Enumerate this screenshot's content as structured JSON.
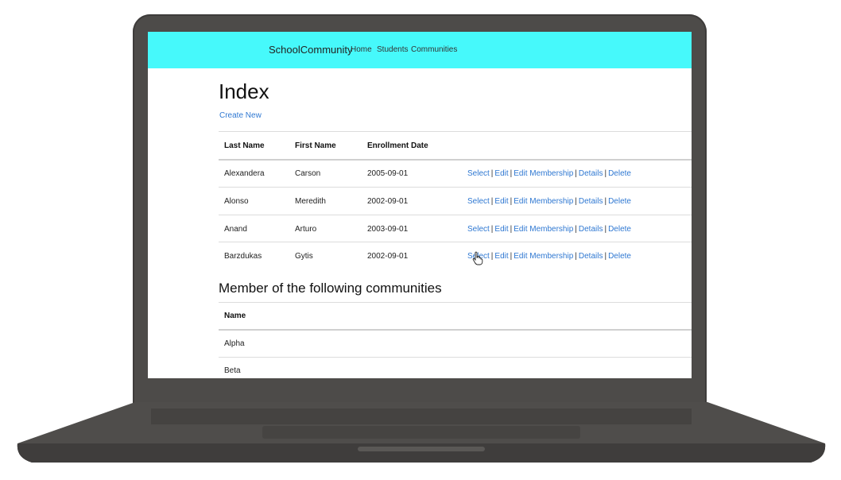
{
  "navbar": {
    "brand": "SchoolCommunity",
    "links": [
      "Home",
      "Students",
      "Communities"
    ]
  },
  "page": {
    "title": "Index",
    "create_link": "Create New"
  },
  "students_table": {
    "columns": [
      "Last Name",
      "First Name",
      "Enrollment Date"
    ],
    "rows": [
      {
        "last_name": "Alexandera",
        "first_name": "Carson",
        "enrollment_date": "2005-09-01"
      },
      {
        "last_name": "Alonso",
        "first_name": "Meredith",
        "enrollment_date": "2002-09-01"
      },
      {
        "last_name": "Anand",
        "first_name": "Arturo",
        "enrollment_date": "2003-09-01"
      },
      {
        "last_name": "Barzdukas",
        "first_name": "Gytis",
        "enrollment_date": "2002-09-01"
      }
    ],
    "actions": [
      "Select",
      "Edit",
      "Edit Membership",
      "Details",
      "Delete"
    ],
    "separator": "|"
  },
  "communities": {
    "title": "Member of the following communities",
    "column": "Name",
    "rows": [
      "Alpha",
      "Beta"
    ]
  },
  "colors": {
    "navbar_bg": "#46f9fb",
    "link": "#2f78d2",
    "laptop_body": "#4d4b49"
  }
}
